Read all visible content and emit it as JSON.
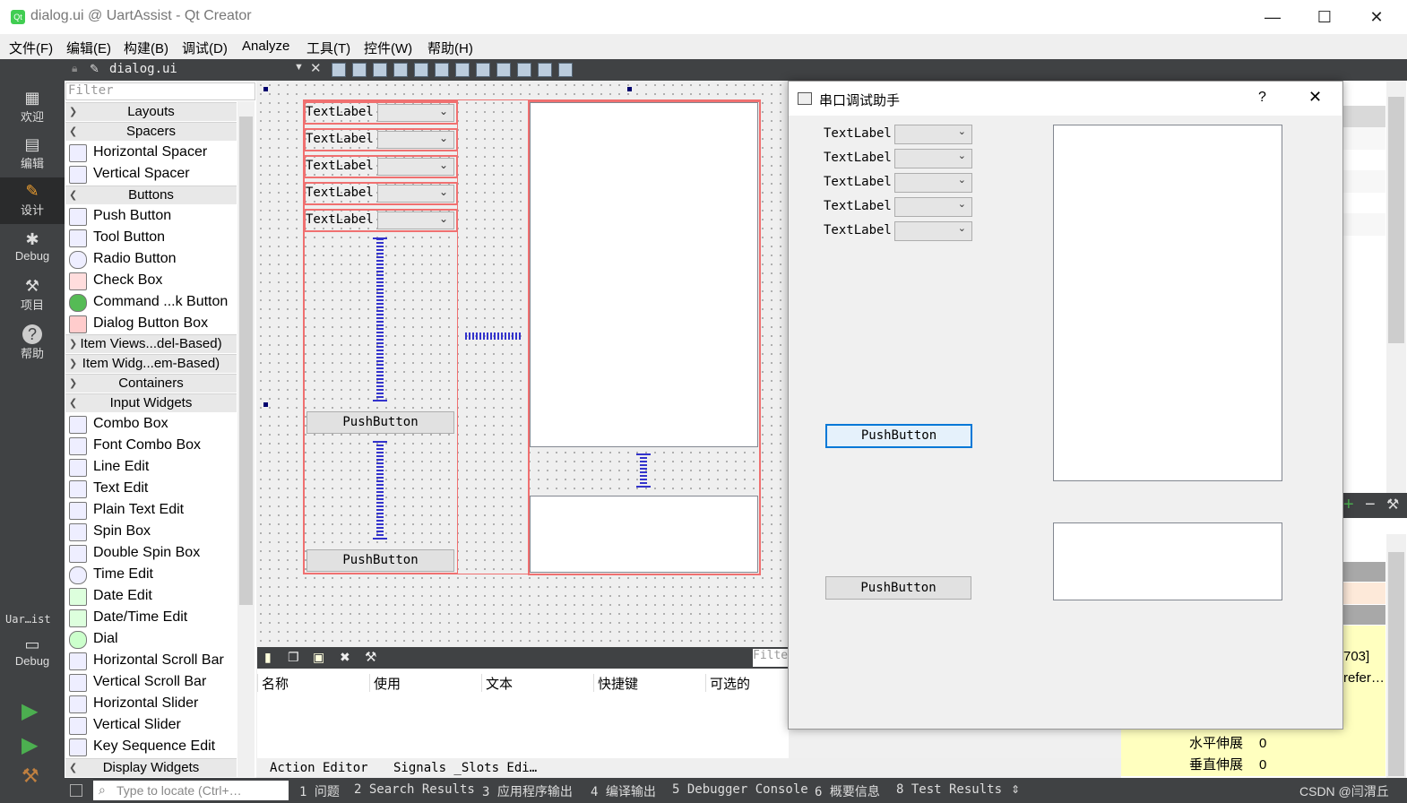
{
  "window": {
    "title": "dialog.ui @ UartAssist - Qt Creator"
  },
  "menu": [
    "文件(F)",
    "编辑(E)",
    "构建(B)",
    "调试(D)",
    "Analyze",
    "工具(T)",
    "控件(W)",
    "帮助(H)"
  ],
  "editor_toolbar": {
    "file_name": "dialog.ui"
  },
  "modes": [
    {
      "label": "欢迎",
      "icon": "grid-icon"
    },
    {
      "label": "编辑",
      "icon": "document-icon"
    },
    {
      "label": "设计",
      "icon": "pencil-icon"
    },
    {
      "label": "Debug",
      "icon": "bug-icon"
    },
    {
      "label": "项目",
      "icon": "wrench-icon"
    },
    {
      "label": "帮助",
      "icon": "help-icon"
    }
  ],
  "kit": {
    "project": "Uar…ist",
    "config": "Debug"
  },
  "widget_box": {
    "filter_placeholder": "Filter",
    "categories": {
      "layouts": "Layouts",
      "spacers": "Spacers",
      "buttons": "Buttons",
      "item_views": "Item Views...del-Based)",
      "item_widgets": "Item Widg...em-Based)",
      "containers": "Containers",
      "input_widgets": "Input Widgets",
      "display_widgets": "Display Widgets"
    },
    "spacers": [
      "Horizontal Spacer",
      "Vertical Spacer"
    ],
    "buttons": [
      "Push Button",
      "Tool Button",
      "Radio Button",
      "Check Box",
      "Command ...k Button",
      "Dialog Button Box"
    ],
    "inputs": [
      "Combo Box",
      "Font Combo Box",
      "Line Edit",
      "Text Edit",
      "Plain Text Edit",
      "Spin Box",
      "Double Spin Box",
      "Time Edit",
      "Date Edit",
      "Date/Time Edit",
      "Dial",
      "Horizontal Scroll Bar",
      "Vertical Scroll Bar",
      "Horizontal Slider",
      "Vertical Slider",
      "Key Sequence Edit"
    ]
  },
  "form": {
    "labels": [
      "TextLabel",
      "TextLabel",
      "TextLabel",
      "TextLabel",
      "TextLabel"
    ],
    "push1": "PushButton",
    "push2": "PushButton"
  },
  "action_editor": {
    "filter": "Filte",
    "columns": [
      "名称",
      "使用",
      "文本",
      "快捷键",
      "可选的"
    ],
    "tabs": [
      "Action Editor",
      "Signals _Slots Edi…"
    ]
  },
  "property_panel": {
    "value_partial_1": "703]",
    "value_partial_2": "refer…",
    "rows": [
      {
        "name": "水平伸展",
        "value": "0"
      },
      {
        "name": "垂直伸展",
        "value": "0"
      }
    ]
  },
  "dialog": {
    "title": "串口调试助手",
    "help": "?",
    "labels": [
      "TextLabel",
      "TextLabel",
      "TextLabel",
      "TextLabel",
      "TextLabel"
    ],
    "push1": "PushButton",
    "push2": "PushButton"
  },
  "status_bar": {
    "locate_placeholder": "Type to locate (Ctrl+…",
    "panes": [
      "1 问题",
      "2 Search Results",
      "3 应用程序输出",
      "4 编译输出",
      "5 Debugger Console",
      "6 概要信息",
      "8 Test Results"
    ],
    "watermark": "CSDN @闫渭丘"
  },
  "colors": {
    "accent_selected": "#0078d7",
    "layout_border": "#f07070",
    "spacer": "#3333cc",
    "mode_bar": "#404244",
    "property_highlight": "#ffffbf"
  }
}
